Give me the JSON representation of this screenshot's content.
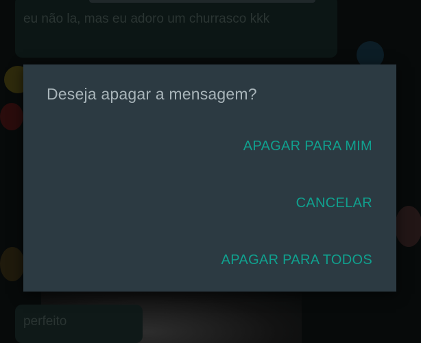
{
  "background": {
    "message_text": "eu não la, mas eu adoro um churrasco kkk",
    "bottom_message": "perfeito"
  },
  "dialog": {
    "title": "Deseja apagar a mensagem?",
    "actions": {
      "delete_for_me": "APAGAR PARA MIM",
      "cancel": "CANCELAR",
      "delete_for_everyone": "APAGAR PARA TODOS"
    }
  },
  "colors": {
    "dialog_background": "#2c3a42",
    "title_text": "#a9b5ba",
    "action_text": "#10a18f",
    "scrim": "#070a0a"
  }
}
